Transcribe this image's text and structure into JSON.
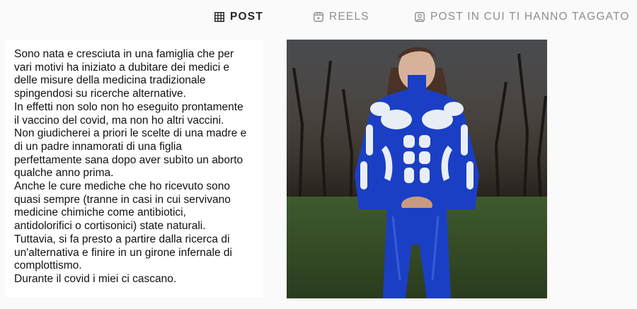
{
  "tabs": [
    {
      "label": "POST",
      "active": true,
      "icon": "grid-icon"
    },
    {
      "label": "REELS",
      "active": false,
      "icon": "reels-icon"
    },
    {
      "label": "POST IN CUI TI HANNO TAGGATO",
      "active": false,
      "icon": "tagged-icon"
    }
  ],
  "posts": [
    {
      "type": "text",
      "caption": "Sono nata e cresciuta in una famiglia che per\nvari motivi ha iniziato a dubitare dei medici e\ndelle misure della medicina tradizionale\nspingendosi su ricerche alternative.\nIn effetti non solo non ho eseguito prontamente\nil vaccino del covid, ma non ho altri vaccini.\nNon giudicherei a priori le scelte di una madre e\ndi un padre innamorati di una figlia\nperfettamente sana dopo aver subìto un aborto\nqualche anno prima.\nAnche le cure mediche che ho ricevuto sono\nquasi sempre (tranne in casi in cui servivano\nmedicine chimiche come antibiotici,\nantidolorifici o cortisonici) state naturali.\nTuttavia, si fa presto a partire dalla ricerca di\nun'alternativa e finire in un girone infernale di\ncomplottismo.\nDurante il covid i miei ci cascano."
    },
    {
      "type": "photo"
    }
  ],
  "colors": {
    "background": "#fafafa",
    "active_tab": "#262626",
    "inactive_tab": "#8e8e8e",
    "outfit_blue": "#1a3fc4"
  }
}
